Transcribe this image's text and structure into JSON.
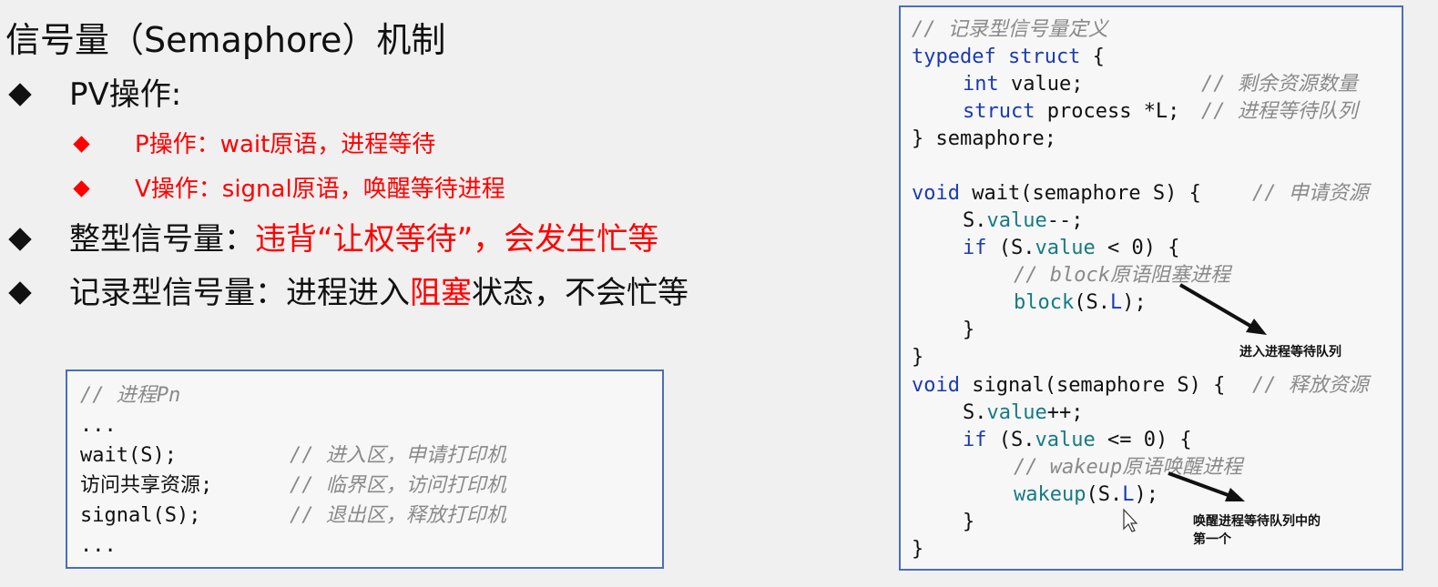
{
  "slide": {
    "title": "信号量（Semaphore）机制",
    "bullets": {
      "pv": "PV操作:",
      "p_op": "P操作：wait原语，进程等待",
      "v_op": "V操作：signal原语，唤醒等待进程",
      "int_sem_prefix": "整型信号量：",
      "int_sem_red": "违背“让权等待”，会发生忙等",
      "rec_sem_prefix": "记录型信号量：进程进入",
      "rec_sem_red": "阻塞",
      "rec_sem_suffix": "状态，不会忙等"
    }
  },
  "process_code": {
    "comment": "// 进程Pn",
    "l1": "...",
    "l2_code": "wait(S);",
    "l2_cmt": "// 进入区，申请打印机",
    "l3_code": "访问共享资源;",
    "l3_cmt": "// 临界区，访问打印机",
    "l4_code": "signal(S);",
    "l4_cmt": "// 退出区，释放打印机",
    "l5": "..."
  },
  "sem_code": {
    "c0": "// 记录型信号量定义",
    "c1_kw": "typedef struct",
    "c1_rest": " {",
    "c2_kw": "int",
    "c2_rest": " value;",
    "c2_cmt": "// 剩余资源数量",
    "c3_kw": "struct",
    "c3_rest": " process *L;",
    "c3_cmt": "// 进程等待队列",
    "c4": "} semaphore;",
    "c5_kw": "void",
    "c5_rest": " wait(semaphore S) {",
    "c5_cmt": "// 申请资源",
    "c6_a": "S.",
    "c6_b": "value",
    "c6_c": "--;",
    "c7_kw": "if",
    "c7_a": " (S.",
    "c7_b": "value",
    "c7_c": " < 0) {",
    "c8_cmt": "// block原语阻塞进程",
    "c9_a": "block",
    "c9_b": "(S.",
    "c9_c": "L",
    "c9_d": ");",
    "c10": "}",
    "c11": "}",
    "c12_kw": "void",
    "c12_rest": " signal(semaphore S) {",
    "c12_cmt": "// 释放资源",
    "c13_a": "S.",
    "c13_b": "value",
    "c13_c": "++;",
    "c14_kw": "if",
    "c14_a": " (S.",
    "c14_b": "value",
    "c14_c": " <= 0) {",
    "c15_cmt": "// wakeup原语唤醒进程",
    "c16_a": "wakeup",
    "c16_b": "(S.",
    "c16_c": "L",
    "c16_d": ");",
    "c17": "}",
    "c18": "}"
  },
  "annotations": {
    "a1": "进入进程等待队列",
    "a2_line1": "唤醒进程等待队列中的",
    "a2_line2": "第一个"
  },
  "colors": {
    "accent_red": "#ff0000",
    "box_border": "#4a6fb8",
    "keyword_blue": "#1a3bb0",
    "member_teal": "#167a84",
    "comment_gray": "#8a8a8a"
  }
}
